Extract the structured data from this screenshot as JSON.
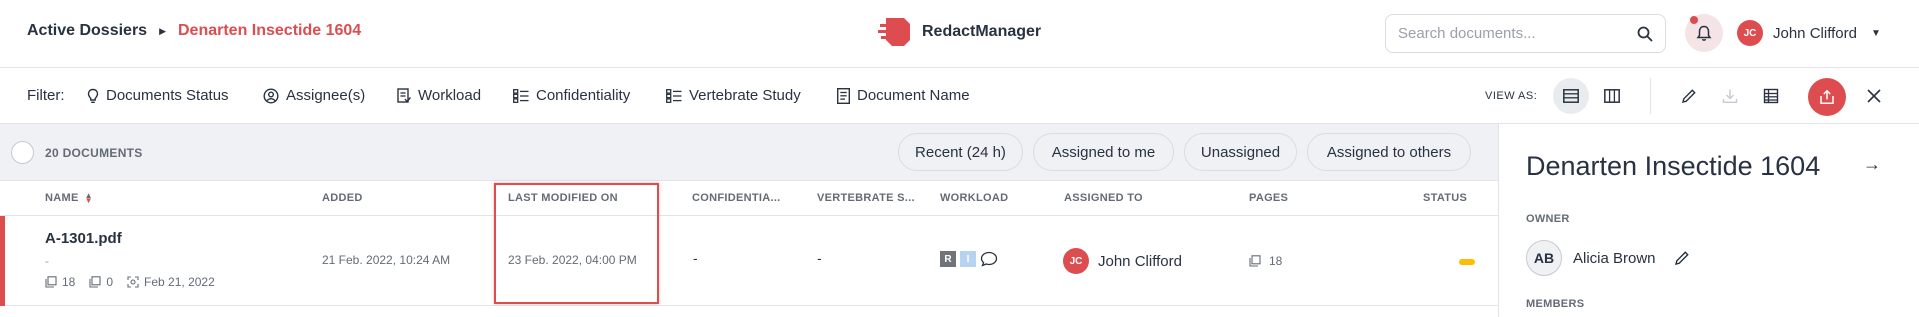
{
  "header": {
    "breadcrumb_root": "Active Dossiers",
    "breadcrumb_current": "Denarten Insectide 1604",
    "app_name": "RedactManager",
    "search_placeholder": "Search documents...",
    "user_initials": "JC",
    "user_name": "John Clifford"
  },
  "filters": {
    "label": "Filter:",
    "items": [
      "Documents Status",
      "Assignee(s)",
      "Workload",
      "Confidentiality",
      "Vertebrate Study",
      "Document Name"
    ],
    "view_as_label": "VIEW AS:"
  },
  "list": {
    "count_label": "20 DOCUMENTS",
    "quick_filters": [
      "Recent (24 h)",
      "Assigned to me",
      "Unassigned",
      "Assigned to others"
    ],
    "columns": [
      "NAME",
      "ADDED",
      "LAST MODIFIED ON",
      "CONFIDENTIA...",
      "VERTEBRATE S...",
      "WORKLOAD",
      "ASSIGNED TO",
      "PAGES",
      "STATUS"
    ],
    "rows": [
      {
        "name": "A-1301.pdf",
        "subtitle": "-",
        "meta_pages": "18",
        "meta_annotations": "0",
        "meta_date": "Feb 21, 2022",
        "added": "21 Feb. 2022, 10:24 AM",
        "modified": "23 Feb. 2022, 04:00 PM",
        "confidentiality": "-",
        "vertebrate": "-",
        "workload_r": "R",
        "workload_i": "I",
        "assignee_initials": "JC",
        "assignee_name": "John Clifford",
        "pages": "18",
        "status_color": "#fdbd00"
      }
    ]
  },
  "side_panel": {
    "title": "Denarten Insectide 1604",
    "owner_label": "OWNER",
    "owner_initials": "AB",
    "owner_name": "Alicia Brown",
    "members_label": "MEMBERS"
  },
  "colors": {
    "accent": "#dd4d50",
    "text": "#283241",
    "muted": "#646b76",
    "status_pending": "#fdbd00"
  }
}
